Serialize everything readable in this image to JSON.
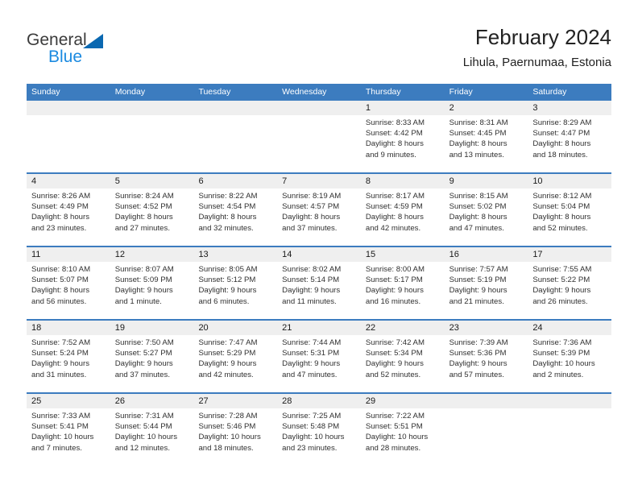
{
  "brand": {
    "name_part1": "General",
    "name_part2": "Blue",
    "triangle_icon": "triangle-icon",
    "color_dark": "#3b3b3b",
    "color_blue": "#1b8ae0",
    "color_triangle": "#0a68b1"
  },
  "header": {
    "title": "February 2024",
    "subtitle": "Lihula, Paernumaa, Estonia",
    "accent_color": "#3c7cbf",
    "weekday_band_color": "#efefef"
  },
  "weekdays": [
    "Sunday",
    "Monday",
    "Tuesday",
    "Wednesday",
    "Thursday",
    "Friday",
    "Saturday"
  ],
  "weeks": [
    {
      "days": [
        {
          "num": "",
          "lines": []
        },
        {
          "num": "",
          "lines": []
        },
        {
          "num": "",
          "lines": []
        },
        {
          "num": "",
          "lines": []
        },
        {
          "num": "1",
          "lines": [
            "Sunrise: 8:33 AM",
            "Sunset: 4:42 PM",
            "Daylight: 8 hours",
            "and 9 minutes."
          ]
        },
        {
          "num": "2",
          "lines": [
            "Sunrise: 8:31 AM",
            "Sunset: 4:45 PM",
            "Daylight: 8 hours",
            "and 13 minutes."
          ]
        },
        {
          "num": "3",
          "lines": [
            "Sunrise: 8:29 AM",
            "Sunset: 4:47 PM",
            "Daylight: 8 hours",
            "and 18 minutes."
          ]
        }
      ]
    },
    {
      "days": [
        {
          "num": "4",
          "lines": [
            "Sunrise: 8:26 AM",
            "Sunset: 4:49 PM",
            "Daylight: 8 hours",
            "and 23 minutes."
          ]
        },
        {
          "num": "5",
          "lines": [
            "Sunrise: 8:24 AM",
            "Sunset: 4:52 PM",
            "Daylight: 8 hours",
            "and 27 minutes."
          ]
        },
        {
          "num": "6",
          "lines": [
            "Sunrise: 8:22 AM",
            "Sunset: 4:54 PM",
            "Daylight: 8 hours",
            "and 32 minutes."
          ]
        },
        {
          "num": "7",
          "lines": [
            "Sunrise: 8:19 AM",
            "Sunset: 4:57 PM",
            "Daylight: 8 hours",
            "and 37 minutes."
          ]
        },
        {
          "num": "8",
          "lines": [
            "Sunrise: 8:17 AM",
            "Sunset: 4:59 PM",
            "Daylight: 8 hours",
            "and 42 minutes."
          ]
        },
        {
          "num": "9",
          "lines": [
            "Sunrise: 8:15 AM",
            "Sunset: 5:02 PM",
            "Daylight: 8 hours",
            "and 47 minutes."
          ]
        },
        {
          "num": "10",
          "lines": [
            "Sunrise: 8:12 AM",
            "Sunset: 5:04 PM",
            "Daylight: 8 hours",
            "and 52 minutes."
          ]
        }
      ]
    },
    {
      "days": [
        {
          "num": "11",
          "lines": [
            "Sunrise: 8:10 AM",
            "Sunset: 5:07 PM",
            "Daylight: 8 hours",
            "and 56 minutes."
          ]
        },
        {
          "num": "12",
          "lines": [
            "Sunrise: 8:07 AM",
            "Sunset: 5:09 PM",
            "Daylight: 9 hours",
            "and 1 minute."
          ]
        },
        {
          "num": "13",
          "lines": [
            "Sunrise: 8:05 AM",
            "Sunset: 5:12 PM",
            "Daylight: 9 hours",
            "and 6 minutes."
          ]
        },
        {
          "num": "14",
          "lines": [
            "Sunrise: 8:02 AM",
            "Sunset: 5:14 PM",
            "Daylight: 9 hours",
            "and 11 minutes."
          ]
        },
        {
          "num": "15",
          "lines": [
            "Sunrise: 8:00 AM",
            "Sunset: 5:17 PM",
            "Daylight: 9 hours",
            "and 16 minutes."
          ]
        },
        {
          "num": "16",
          "lines": [
            "Sunrise: 7:57 AM",
            "Sunset: 5:19 PM",
            "Daylight: 9 hours",
            "and 21 minutes."
          ]
        },
        {
          "num": "17",
          "lines": [
            "Sunrise: 7:55 AM",
            "Sunset: 5:22 PM",
            "Daylight: 9 hours",
            "and 26 minutes."
          ]
        }
      ]
    },
    {
      "days": [
        {
          "num": "18",
          "lines": [
            "Sunrise: 7:52 AM",
            "Sunset: 5:24 PM",
            "Daylight: 9 hours",
            "and 31 minutes."
          ]
        },
        {
          "num": "19",
          "lines": [
            "Sunrise: 7:50 AM",
            "Sunset: 5:27 PM",
            "Daylight: 9 hours",
            "and 37 minutes."
          ]
        },
        {
          "num": "20",
          "lines": [
            "Sunrise: 7:47 AM",
            "Sunset: 5:29 PM",
            "Daylight: 9 hours",
            "and 42 minutes."
          ]
        },
        {
          "num": "21",
          "lines": [
            "Sunrise: 7:44 AM",
            "Sunset: 5:31 PM",
            "Daylight: 9 hours",
            "and 47 minutes."
          ]
        },
        {
          "num": "22",
          "lines": [
            "Sunrise: 7:42 AM",
            "Sunset: 5:34 PM",
            "Daylight: 9 hours",
            "and 52 minutes."
          ]
        },
        {
          "num": "23",
          "lines": [
            "Sunrise: 7:39 AM",
            "Sunset: 5:36 PM",
            "Daylight: 9 hours",
            "and 57 minutes."
          ]
        },
        {
          "num": "24",
          "lines": [
            "Sunrise: 7:36 AM",
            "Sunset: 5:39 PM",
            "Daylight: 10 hours",
            "and 2 minutes."
          ]
        }
      ]
    },
    {
      "days": [
        {
          "num": "25",
          "lines": [
            "Sunrise: 7:33 AM",
            "Sunset: 5:41 PM",
            "Daylight: 10 hours",
            "and 7 minutes."
          ]
        },
        {
          "num": "26",
          "lines": [
            "Sunrise: 7:31 AM",
            "Sunset: 5:44 PM",
            "Daylight: 10 hours",
            "and 12 minutes."
          ]
        },
        {
          "num": "27",
          "lines": [
            "Sunrise: 7:28 AM",
            "Sunset: 5:46 PM",
            "Daylight: 10 hours",
            "and 18 minutes."
          ]
        },
        {
          "num": "28",
          "lines": [
            "Sunrise: 7:25 AM",
            "Sunset: 5:48 PM",
            "Daylight: 10 hours",
            "and 23 minutes."
          ]
        },
        {
          "num": "29",
          "lines": [
            "Sunrise: 7:22 AM",
            "Sunset: 5:51 PM",
            "Daylight: 10 hours",
            "and 28 minutes."
          ]
        },
        {
          "num": "",
          "lines": []
        },
        {
          "num": "",
          "lines": []
        }
      ]
    }
  ]
}
